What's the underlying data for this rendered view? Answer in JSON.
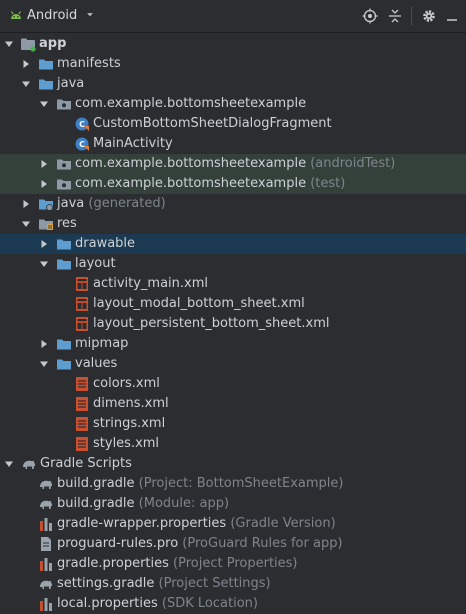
{
  "toolbar": {
    "view_label": "Android",
    "icons": [
      "android-icon",
      "chevron-down-icon",
      "locate-icon",
      "collapse-all-icon",
      "gear-icon",
      "hide-panel-icon"
    ]
  },
  "tree": [
    {
      "label": "app",
      "hint": "",
      "icon": "module-icon",
      "arrow": "down"
    },
    {
      "label": "manifests",
      "hint": "",
      "icon": "folder-icon",
      "arrow": "right"
    },
    {
      "label": "java",
      "hint": "",
      "icon": "folder-icon",
      "arrow": "down"
    },
    {
      "label": "com.example.bottomsheetexample",
      "hint": "",
      "icon": "package-icon",
      "arrow": "down"
    },
    {
      "label": "CustomBottomSheetDialogFragment",
      "hint": "",
      "icon": "kotlin-class-icon",
      "arrow": ""
    },
    {
      "label": "MainActivity",
      "hint": "",
      "icon": "kotlin-class-icon",
      "arrow": ""
    },
    {
      "label": "com.example.bottomsheetexample",
      "hint": "(androidTest)",
      "icon": "package-icon",
      "arrow": "right"
    },
    {
      "label": "com.example.bottomsheetexample",
      "hint": "(test)",
      "icon": "package-icon",
      "arrow": "right"
    },
    {
      "label": "java",
      "hint": "(generated)",
      "icon": "generated-folder-icon",
      "arrow": "right"
    },
    {
      "label": "res",
      "hint": "",
      "icon": "resource-folder-icon",
      "arrow": "down"
    },
    {
      "label": "drawable",
      "hint": "",
      "icon": "folder-icon",
      "arrow": "right"
    },
    {
      "label": "layout",
      "hint": "",
      "icon": "folder-icon",
      "arrow": "down"
    },
    {
      "label": "activity_main.xml",
      "hint": "",
      "icon": "layout-xml-icon",
      "arrow": ""
    },
    {
      "label": "layout_modal_bottom_sheet.xml",
      "hint": "",
      "icon": "layout-xml-icon",
      "arrow": ""
    },
    {
      "label": "layout_persistent_bottom_sheet.xml",
      "hint": "",
      "icon": "layout-xml-icon",
      "arrow": ""
    },
    {
      "label": "mipmap",
      "hint": "",
      "icon": "folder-icon",
      "arrow": "right"
    },
    {
      "label": "values",
      "hint": "",
      "icon": "folder-icon",
      "arrow": "down"
    },
    {
      "label": "colors.xml",
      "hint": "",
      "icon": "values-xml-icon",
      "arrow": ""
    },
    {
      "label": "dimens.xml",
      "hint": "",
      "icon": "values-xml-icon",
      "arrow": ""
    },
    {
      "label": "strings.xml",
      "hint": "",
      "icon": "values-xml-icon",
      "arrow": ""
    },
    {
      "label": "styles.xml",
      "hint": "",
      "icon": "values-xml-icon",
      "arrow": ""
    },
    {
      "label": "Gradle Scripts",
      "hint": "",
      "icon": "gradle-icon",
      "arrow": "down"
    },
    {
      "label": "build.gradle",
      "hint": "(Project: BottomSheetExample)",
      "icon": "gradle-icon",
      "arrow": ""
    },
    {
      "label": "build.gradle",
      "hint": "(Module: app)",
      "icon": "gradle-icon",
      "arrow": ""
    },
    {
      "label": "gradle-wrapper.properties",
      "hint": "(Gradle Version)",
      "icon": "properties-icon",
      "arrow": ""
    },
    {
      "label": "proguard-rules.pro",
      "hint": "(ProGuard Rules for app)",
      "icon": "file-icon",
      "arrow": ""
    },
    {
      "label": "gradle.properties",
      "hint": "(Project Properties)",
      "icon": "properties-icon",
      "arrow": ""
    },
    {
      "label": "settings.gradle",
      "hint": "(Project Settings)",
      "icon": "gradle-icon",
      "arrow": ""
    },
    {
      "label": "local.properties",
      "hint": "(SDK Location)",
      "icon": "properties-icon",
      "arrow": ""
    }
  ]
}
